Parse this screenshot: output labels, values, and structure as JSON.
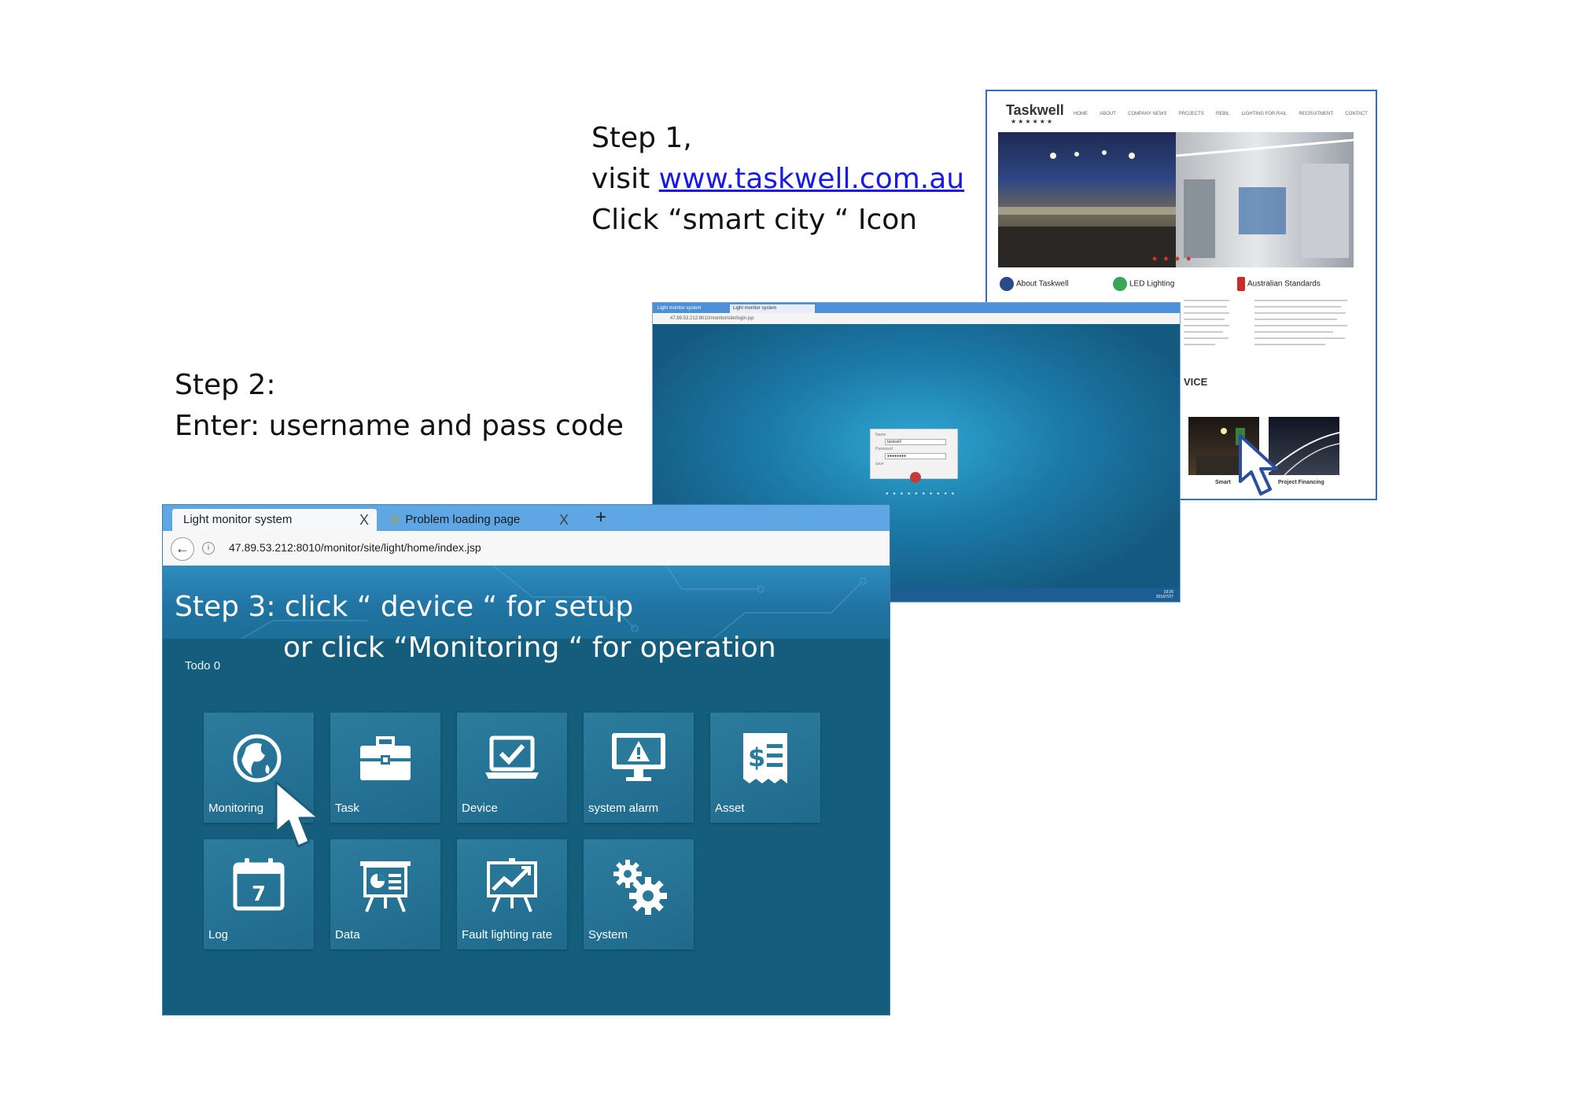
{
  "steps": {
    "step1": {
      "line1": "Step 1,",
      "visit_prefix": "visit ",
      "link": "www.taskwell.com.au",
      "line3": "Click “smart city “ Icon"
    },
    "step2": {
      "line1": "Step 2:",
      "line2": "Enter: username and pass code"
    },
    "step3": {
      "line1": "Step 3:  click “ device “ for setup",
      "line2": "or  click “Monitoring “ for operation"
    }
  },
  "website": {
    "logo": "Taskwell",
    "stars": "★★★★★★",
    "nav": [
      "HOME",
      "ABOUT",
      "COMPANY NEWS",
      "PROJECTS",
      "REBIL",
      "LIGHTING FOR RAIL",
      "RECRUITMENT",
      "CONTACT"
    ],
    "columns": [
      {
        "title": "About Taskwell",
        "icon": "kangaroo-icon"
      },
      {
        "title": "LED Lighting",
        "icon": "recycle-globe-icon"
      },
      {
        "title": "Australian Standards",
        "icon": "standards-icon"
      }
    ],
    "section_heading": "VICE",
    "thumbnails": [
      {
        "caption": "Smart"
      },
      {
        "caption": "Project Financing"
      }
    ],
    "carousel_dots": "◆ ◆ ◆ ◆"
  },
  "login_screen": {
    "tabs": [
      "Light monitor system",
      "Light monitor system"
    ],
    "address": "47.89.53.212:8010/monitor/site/login.jsp",
    "name_label": "Name",
    "name_value": "taskwell",
    "password_label": "Password",
    "password_value": "●●●●●●●●",
    "remember_label": "save",
    "footer_dots": "● ● ● ● ● ● ● ● ● ●",
    "clock_time": "19:26",
    "clock_date": "2016/7/27"
  },
  "dashboard": {
    "tabs": [
      {
        "label": "Light monitor system",
        "close": "X"
      },
      {
        "label": "Problem loading page",
        "close": "X"
      }
    ],
    "new_tab": "+",
    "url": "47.89.53.212:8010/monitor/site/light/home/index.jsp",
    "todo": "Todo 0",
    "tiles": [
      {
        "label": "Monitoring",
        "icon": "globe-icon"
      },
      {
        "label": "Task",
        "icon": "briefcase-icon"
      },
      {
        "label": "Device",
        "icon": "laptop-check-icon"
      },
      {
        "label": "system alarm",
        "icon": "monitor-alert-icon"
      },
      {
        "label": "Asset",
        "icon": "receipt-dollar-icon"
      },
      {
        "label": "Log",
        "icon": "calendar-icon"
      },
      {
        "label": "Data",
        "icon": "presentation-chart-icon"
      },
      {
        "label": "Fault lighting rate",
        "icon": "trend-chart-icon"
      },
      {
        "label": "System",
        "icon": "gears-icon"
      }
    ],
    "calendar_day": "7"
  },
  "colors": {
    "link": "#1a1ae6",
    "dashboard_bg": "#145d7c",
    "tile": "#2c7c9e",
    "tab_bar": "#5fa6e4",
    "frame_border": "#2f6fc4"
  }
}
